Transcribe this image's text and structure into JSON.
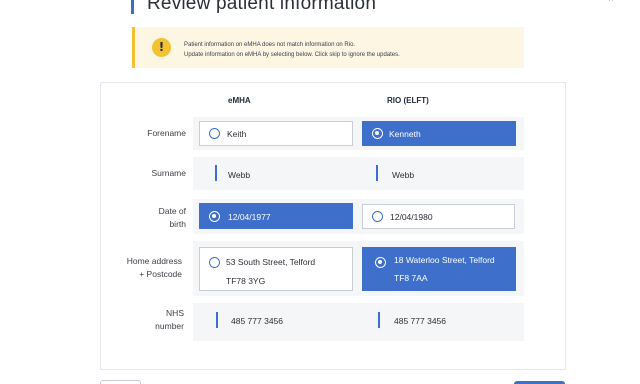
{
  "page": {
    "title": "Review patient information"
  },
  "alert": {
    "line1": "Patient information on eMHA does not match information on Rio.",
    "line2": "Update information on eMHA by selecting below. Click skip to ignore the updates.",
    "icon": "warning-icon",
    "accent": "#f2c230"
  },
  "columns": {
    "emha": "eMHA",
    "rio": "RIO (ELFT)"
  },
  "rows": {
    "forename": {
      "label": "Forename",
      "emha": "Keith",
      "rio": "Kenneth",
      "selected": "rio"
    },
    "surname": {
      "label": "Surname",
      "emha": "Webb",
      "rio": "Webb"
    },
    "dob": {
      "label_line1": "Date of",
      "label_line2": "birth",
      "emha": "12/04/1977",
      "rio": "12/04/1980",
      "selected": "emha"
    },
    "address": {
      "label_line1": "Home address",
      "label_line2": "+ Postcode",
      "emha_line1": "53 South Street, Telford",
      "emha_line2": "TF78 3YG",
      "rio_line1": "18 Waterloo Street, Telford",
      "rio_line2": "TF8 7AA",
      "selected": "rio"
    },
    "nhs": {
      "label_line1": "NHS",
      "label_line2": "number",
      "emha": "485 777 3456",
      "rio": "485 777 3456"
    }
  },
  "colors": {
    "selected": "#3d6fcb",
    "row_background": "#f5f6f8"
  }
}
